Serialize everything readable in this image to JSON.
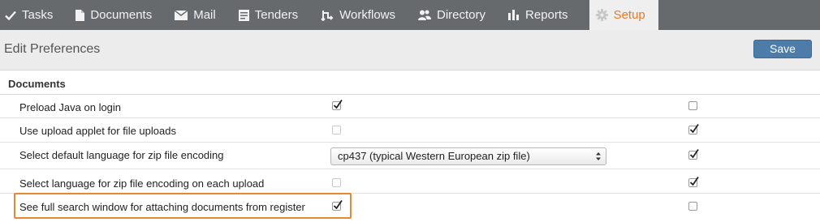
{
  "nav": {
    "tabs": [
      {
        "label": "Tasks",
        "icon": "checkmark-icon"
      },
      {
        "label": "Documents",
        "icon": "document-icon"
      },
      {
        "label": "Mail",
        "icon": "envelope-icon"
      },
      {
        "label": "Tenders",
        "icon": "tenders-icon"
      },
      {
        "label": "Workflows",
        "icon": "workflow-icon"
      },
      {
        "label": "Directory",
        "icon": "people-icon"
      },
      {
        "label": "Reports",
        "icon": "bar-chart-icon"
      },
      {
        "label": "Setup",
        "icon": "gear-icon",
        "active": true
      }
    ]
  },
  "header": {
    "title": "Edit Preferences",
    "save_label": "Save"
  },
  "section": {
    "title": "Documents",
    "rows": [
      {
        "label": "Preload Java on login",
        "col1": "checked",
        "col2": "unchecked"
      },
      {
        "label": "Use upload applet for file uploads",
        "col1": "disabled",
        "col2": "checked"
      },
      {
        "label": "Select default language for zip file encoding",
        "select_value": "cp437 (typical Western European zip file)",
        "col2": "checked"
      },
      {
        "label": "Select language for zip file encoding on each upload",
        "col1": "disabled",
        "col2": "checked"
      },
      {
        "label": "See full search window for attaching documents from register",
        "col1": "checked",
        "col2": "unchecked",
        "highlighted": true
      }
    ]
  },
  "colors": {
    "nav_bg": "#666a6d",
    "active_accent": "#e8782a",
    "save_button": "#4d7ca9",
    "highlight_border": "#e8872e"
  }
}
